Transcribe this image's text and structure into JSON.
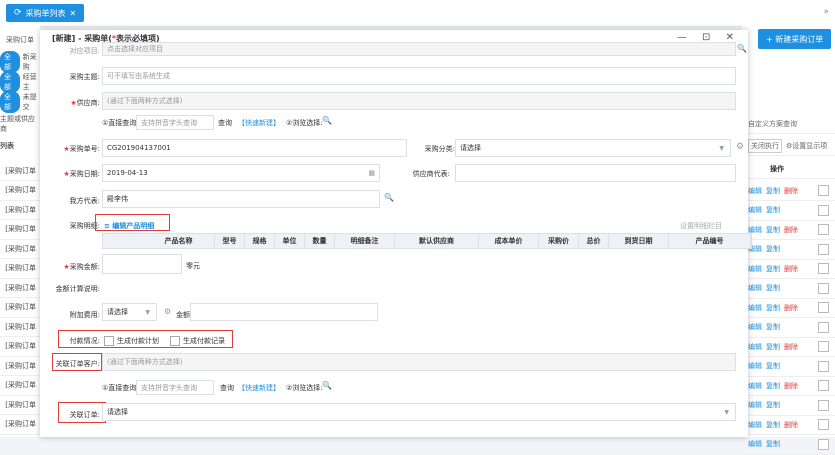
{
  "top": {
    "tab_label": "采购单列表",
    "close": "✕",
    "more": "»"
  },
  "bg_left": {
    "title": "采购订单",
    "tag1": "全部",
    "tag1_text": "新采购",
    "tag2": "全部",
    "tag2_text": "经营主",
    "tag3": "全部",
    "tag3_text": "未提交",
    "filter": "主题或供应商",
    "list_title": "列表",
    "rows": [
      "[采购订单",
      "[采购订单",
      "[采购订单",
      "[采购订单",
      "[采购订单",
      "[采购订单",
      "[采购订单",
      "[采购订单",
      "[采购订单",
      "[采购订单",
      "[采购订单",
      "[采购订单",
      "[采购订单",
      "[采购订单"
    ]
  },
  "bg_right": {
    "new_btn": "+ 新建采购订单",
    "custom_query": "自定义方案查询",
    "close_row": "关闭执行",
    "settings": "设置显示项",
    "op_header": "操作",
    "op_edit": "编辑",
    "op_copy": "复制",
    "op_del": "删除"
  },
  "modal": {
    "title_prefix": "[新建] - 采购单(",
    "title_star": "*",
    "title_suffix": "表示必填项)",
    "controls": "— ⊡ ✕",
    "project_label": "对应项目:",
    "project_placeholder": "点击选择对应项目",
    "subject_label": "采购主题:",
    "subject_placeholder": "可不填写由系统生成",
    "supplier_label": "供应商:",
    "supplier_placeholder": "(通过下面两种方式选择)",
    "way1": "①直接查询:",
    "way1_placeholder": "支持拼音字头查询",
    "query_btn": "查询",
    "quick_new": "【快速新建】",
    "way2": "②浏览选择:",
    "order_no_label": "采购单号:",
    "order_no": "CG201904137001",
    "category_label": "采购分类:",
    "category_value": "请选择",
    "date_label": "采购日期:",
    "date_value": "2019-04-13",
    "supplier_rep_label": "供应商代表:",
    "our_rep_label": "我方代表:",
    "our_rep_value": "殿李伟",
    "detail_label": "采购明细:",
    "edit_detail": "≡ 编辑产品明细",
    "set_detail_cols": "设置明细栏目",
    "table_headers": [
      "产品名称",
      "型号",
      "规格",
      "单位",
      "数量",
      "明细备注",
      "默认供应商",
      "成本单价",
      "采购价",
      "总价",
      "到货日期",
      "产品编号"
    ],
    "amount_label": "采购金额:",
    "amount_unit": "零元",
    "amount_calc_label": "金额计算说明:",
    "extra_fee_label": "附加费用:",
    "extra_fee_value": "请选择",
    "amount2_label": "金额:",
    "pay_label": "付款情况:",
    "pay_plan": "生成付款计划",
    "pay_record": "生成付款记录",
    "rel_customer_label": "关联订单客户:",
    "rel_customer_placeholder": "(通过下面两种方式选择)",
    "rel_order_label": "关联订单:",
    "rel_order_value": "请选择"
  }
}
